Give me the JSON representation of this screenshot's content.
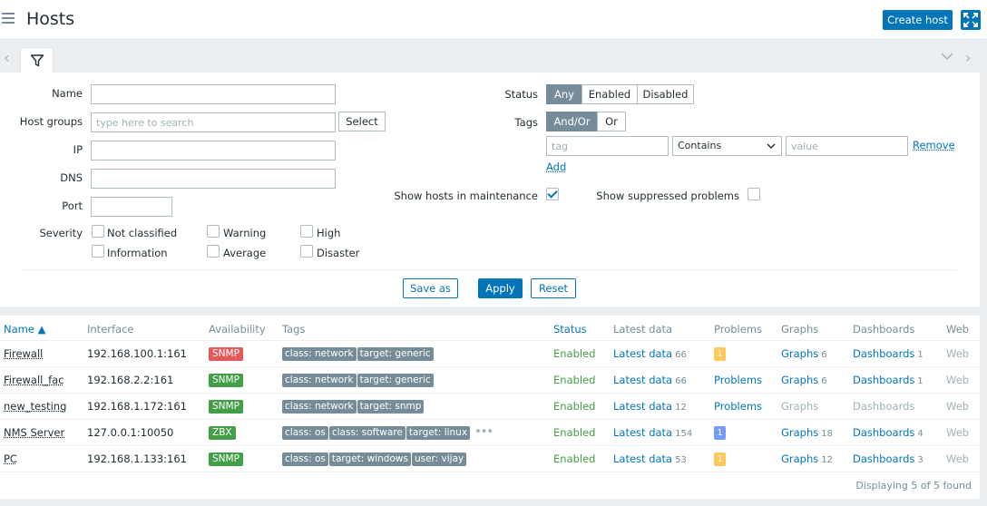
{
  "header": {
    "title": "Hosts",
    "create_host": "Create host"
  },
  "filter": {
    "labels": {
      "name": "Name",
      "host_groups": "Host groups",
      "ip": "IP",
      "dns": "DNS",
      "port": "Port",
      "severity": "Severity",
      "status": "Status",
      "tags": "Tags",
      "show_maintenance": "Show hosts in maintenance",
      "show_suppressed": "Show suppressed problems"
    },
    "host_groups_placeholder": "type here to search",
    "select_button": "Select",
    "severities": [
      "Not classified",
      "Warning",
      "High",
      "Information",
      "Average",
      "Disaster"
    ],
    "status_options": [
      "Any",
      "Enabled",
      "Disabled"
    ],
    "status_selected": "Any",
    "tag_operator_options": [
      "And/Or",
      "Or"
    ],
    "tag_operator_selected": "And/Or",
    "tag_placeholder": "tag",
    "tag_condition": "Contains",
    "value_placeholder": "value",
    "remove_link": "Remove",
    "add_link": "Add",
    "show_maintenance_checked": true,
    "show_suppressed_checked": false,
    "buttons": {
      "save_as": "Save as",
      "apply": "Apply",
      "reset": "Reset"
    }
  },
  "table": {
    "columns": [
      "Name ▲",
      "Interface",
      "Availability",
      "Tags",
      "Status",
      "Latest data",
      "Problems",
      "Graphs",
      "Dashboards",
      "Web"
    ],
    "rows": [
      {
        "name": "Firewall",
        "interface": "192.168.100.1:161",
        "availability": "SNMP",
        "availability_color": "#e45959",
        "tags": [
          "class: network",
          "target: generic"
        ],
        "tags_more": "",
        "status": "Enabled",
        "latest_data": "Latest data",
        "latest_count": "66",
        "problems": "1",
        "problems_color": "#ffc859",
        "graphs": "Graphs",
        "graphs_count": "6",
        "dashboards": "Dashboards",
        "dashboards_count": "1",
        "web": "Web"
      },
      {
        "name": "Firewall_fac",
        "interface": "192.168.2.2:161",
        "availability": "SNMP",
        "availability_color": "#429e47",
        "tags": [
          "class: network",
          "target: generic"
        ],
        "tags_more": "",
        "status": "Enabled",
        "latest_data": "Latest data",
        "latest_count": "66",
        "problems": "Problems",
        "problems_color": "",
        "graphs": "Graphs",
        "graphs_count": "6",
        "dashboards": "Dashboards",
        "dashboards_count": "1",
        "web": "Web"
      },
      {
        "name": "new_testing",
        "interface": "192.168.1.172:161",
        "availability": "SNMP",
        "availability_color": "#429e47",
        "tags": [
          "class: network",
          "target: snmp"
        ],
        "tags_more": "",
        "status": "Enabled",
        "latest_data": "Latest data",
        "latest_count": "12",
        "problems": "Problems",
        "problems_color": "",
        "graphs": "Graphs",
        "graphs_count": "",
        "dashboards": "Dashboards",
        "dashboards_count": "",
        "web": "Web"
      },
      {
        "name": "NMS Server",
        "interface": "127.0.0.1:10050",
        "availability": "ZBX",
        "availability_color": "#429e47",
        "tags": [
          "class: os",
          "class: software",
          "target: linux"
        ],
        "tags_more": "•••",
        "status": "Enabled",
        "latest_data": "Latest data",
        "latest_count": "154",
        "problems": "1",
        "problems_color": "#7499ff",
        "graphs": "Graphs",
        "graphs_count": "18",
        "dashboards": "Dashboards",
        "dashboards_count": "4",
        "web": "Web"
      },
      {
        "name": "PC",
        "interface": "192.168.1.133:161",
        "availability": "SNMP",
        "availability_color": "#429e47",
        "tags": [
          "class: os",
          "target: windows",
          "user: vijay"
        ],
        "tags_more": "",
        "status": "Enabled",
        "latest_data": "Latest data",
        "latest_count": "53",
        "problems": "1",
        "problems_color": "#ffc859",
        "graphs": "Graphs",
        "graphs_count": "12",
        "dashboards": "Dashboards",
        "dashboards_count": "3",
        "web": "Web"
      }
    ],
    "footer": "Displaying 5 of 5 found"
  }
}
